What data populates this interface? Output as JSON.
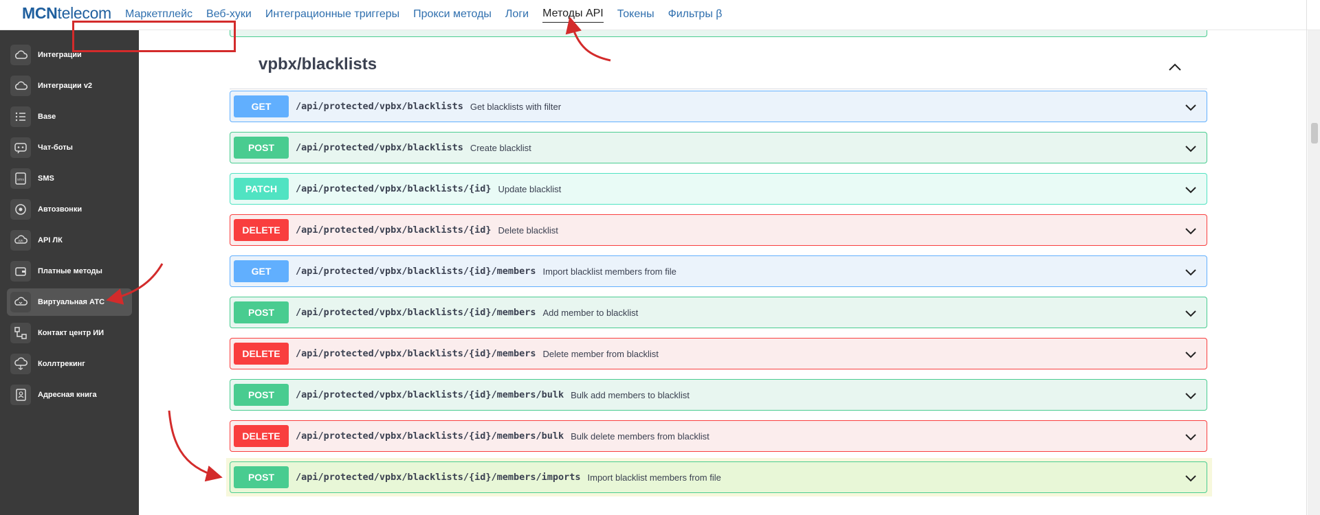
{
  "brand": {
    "part1": "MCN",
    "part2": "telecom"
  },
  "nav": [
    {
      "label": "Маркетплейс",
      "active": false
    },
    {
      "label": "Веб-хуки",
      "active": false
    },
    {
      "label": "Интеграционные триггеры",
      "active": false
    },
    {
      "label": "Прокси методы",
      "active": false
    },
    {
      "label": "Логи",
      "active": false
    },
    {
      "label": "Методы API",
      "active": true
    },
    {
      "label": "Токены",
      "active": false
    },
    {
      "label": "Фильтры β",
      "active": false
    }
  ],
  "sidebar": [
    {
      "label": "Интеграции",
      "icon": "cloud-icon",
      "active": false
    },
    {
      "label": "Интеграции v2",
      "icon": "cloud-icon",
      "active": false
    },
    {
      "label": "Base",
      "icon": "list-icon",
      "active": false
    },
    {
      "label": "Чат-боты",
      "icon": "chatbot-icon",
      "active": false
    },
    {
      "label": "SMS",
      "icon": "sms-icon",
      "active": false
    },
    {
      "label": "Автозвонки",
      "icon": "autocall-icon",
      "active": false
    },
    {
      "label": "API ЛК",
      "icon": "api-cloud-icon",
      "active": false
    },
    {
      "label": "Платные методы",
      "icon": "wallet-icon",
      "active": false
    },
    {
      "label": "Виртуальная АТС",
      "icon": "cloud-phone-icon",
      "active": true
    },
    {
      "label": "Контакт центр ИИ",
      "icon": "network-icon",
      "active": false
    },
    {
      "label": "Коллтрекинг",
      "icon": "cloud-tracking-icon",
      "active": false
    },
    {
      "label": "Адресная книга",
      "icon": "contact-book-icon",
      "active": false
    }
  ],
  "section": {
    "title": "vpbx/blacklists"
  },
  "operations": [
    {
      "method": "GET",
      "path": "/api/protected/vpbx/blacklists",
      "summary": "Get blacklists with filter",
      "highlighted": false
    },
    {
      "method": "POST",
      "path": "/api/protected/vpbx/blacklists",
      "summary": "Create blacklist",
      "highlighted": false
    },
    {
      "method": "PATCH",
      "path": "/api/protected/vpbx/blacklists/{id}",
      "summary": "Update blacklist",
      "highlighted": false
    },
    {
      "method": "DELETE",
      "path": "/api/protected/vpbx/blacklists/{id}",
      "summary": "Delete blacklist",
      "highlighted": false
    },
    {
      "method": "GET",
      "path": "/api/protected/vpbx/blacklists/{id}/members",
      "summary": "Import blacklist members from file",
      "highlighted": false
    },
    {
      "method": "POST",
      "path": "/api/protected/vpbx/blacklists/{id}/members",
      "summary": "Add member to blacklist",
      "highlighted": false
    },
    {
      "method": "DELETE",
      "path": "/api/protected/vpbx/blacklists/{id}/members",
      "summary": "Delete member from blacklist",
      "highlighted": false
    },
    {
      "method": "POST",
      "path": "/api/protected/vpbx/blacklists/{id}/members/bulk",
      "summary": "Bulk add members to blacklist",
      "highlighted": false
    },
    {
      "method": "DELETE",
      "path": "/api/protected/vpbx/blacklists/{id}/members/bulk",
      "summary": "Bulk delete members from blacklist",
      "highlighted": false
    },
    {
      "method": "POST",
      "path": "/api/protected/vpbx/blacklists/{id}/members/imports",
      "summary": "Import blacklist members from file",
      "highlighted": true
    }
  ],
  "colors": {
    "get": "#61affe",
    "post": "#49cc90",
    "patch": "#50e3c2",
    "delete": "#f93e3e",
    "annotation": "#d32b2b",
    "sidebar_bg": "#3a3a3a"
  }
}
